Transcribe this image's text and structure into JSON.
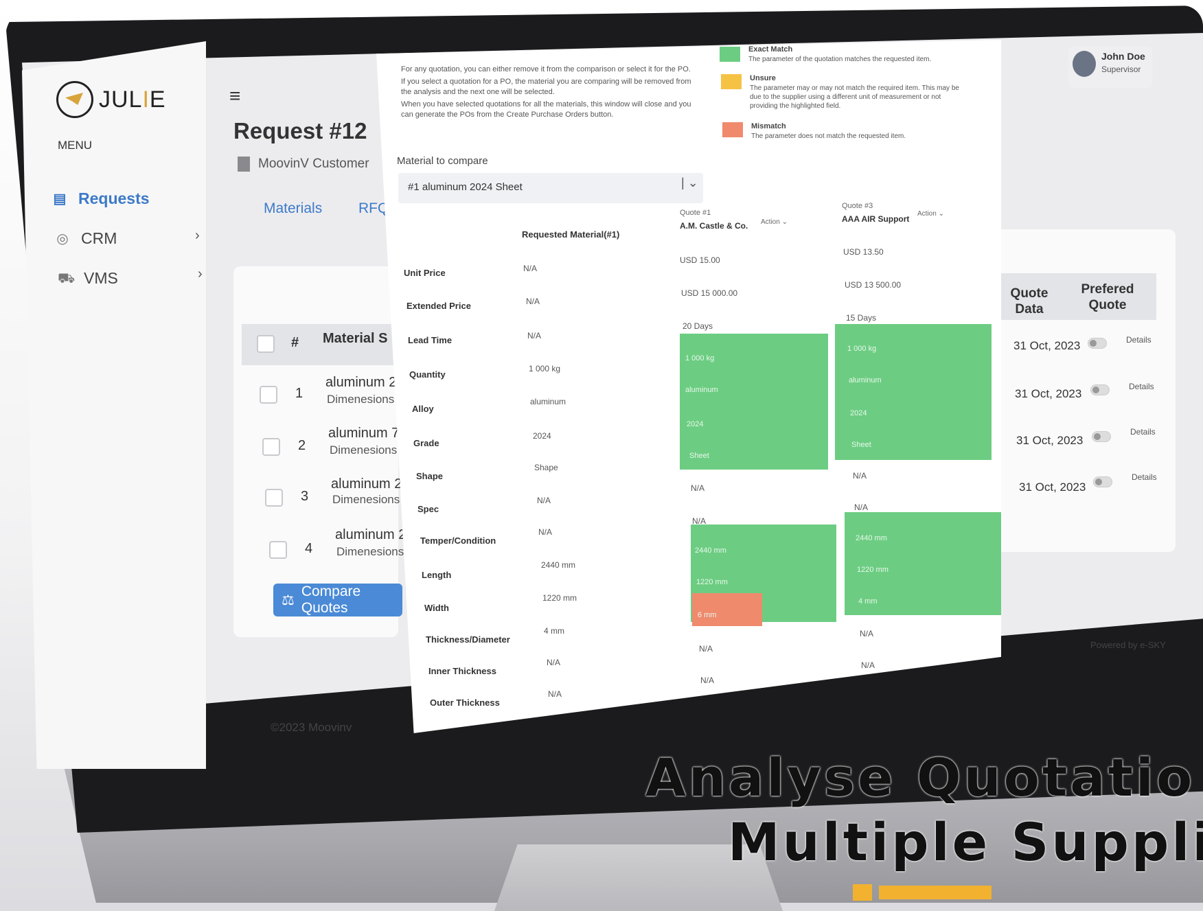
{
  "sidebar": {
    "logo_text_a": "JUL",
    "logo_text_b": "I",
    "logo_text_c": "E",
    "menu_label": "MENU",
    "items": [
      {
        "label": "Requests",
        "icon": "requests-icon"
      },
      {
        "label": "CRM",
        "icon": "user-circle-icon"
      },
      {
        "label": "VMS",
        "icon": "truck-icon"
      }
    ],
    "chevron": "›"
  },
  "header": {
    "title": "Request #12",
    "customer": "MoovinV Customer",
    "tabs": [
      "Materials",
      "RFQ"
    ]
  },
  "table": {
    "header_num": "#",
    "header_material": "Material S",
    "rows": [
      {
        "num": "1",
        "title": "aluminum 2",
        "sub": "Dimenesions"
      },
      {
        "num": "2",
        "title": "aluminum 7",
        "sub": "Dimenesions"
      },
      {
        "num": "3",
        "title": "aluminum 2",
        "sub": "Dimenesions"
      },
      {
        "num": "4",
        "title": "aluminum 2",
        "sub": "Dimenesions"
      }
    ],
    "compare_button": "Compare Quotes",
    "copyright": "©2023 Moovinv"
  },
  "right": {
    "col_quote_data": "Quote Data",
    "col_prefered": "Prefered Quote",
    "dates": [
      "31 Oct, 2023",
      "31 Oct, 2023",
      "31 Oct, 2023",
      "31 Oct, 2023"
    ],
    "details": "Details",
    "powered": "Powered by e-SKY"
  },
  "user": {
    "name": "John Doe",
    "role": "Supervisor"
  },
  "modal": {
    "notes": [
      "For any quotation, you can either remove it from the comparison or select it for the PO.",
      "If you select a quotation for a PO, the material you are comparing will be removed from the analysis and the next one will be selected.",
      "When you have selected quotations for all the materials, this window will close and you can generate the POs from the Create Purchase Orders button."
    ],
    "legend": [
      {
        "title": "Exact Match",
        "desc": "The parameter of the quotation matches the requested item.",
        "color": "#6ccd82"
      },
      {
        "title": "Unsure",
        "desc": "The parameter may or may not match the required item. This may be due to the supplier using a different unit of measurement or not providing the highlighted field.",
        "color": "#f5c244"
      },
      {
        "title": "Mismatch",
        "desc": "The parameter does not match the requested item.",
        "color": "#ef8a6d"
      }
    ],
    "material_label": "Material to compare",
    "material_value": "#1 aluminum 2024 Sheet",
    "requested_header": "Requested Material(#1)",
    "quotes": [
      {
        "label": "Quote #1",
        "name": "A.M. Castle & Co.",
        "action": "Action ⌄"
      },
      {
        "label": "Quote #3",
        "name": "AAA AIR Support",
        "action": "Action ⌄"
      }
    ],
    "rows": [
      {
        "label": "Unit Price",
        "req": "N/A",
        "q1": "USD 15.00",
        "q2": "USD 13.50"
      },
      {
        "label": "Extended Price",
        "req": "N/A",
        "q1": "USD 15 000.00",
        "q2": "USD 13 500.00"
      },
      {
        "label": "Lead Time",
        "req": "N/A",
        "q1": "20 Days",
        "q2": "15 Days"
      },
      {
        "label": "Quantity",
        "req": "1 000 kg",
        "q1": "1 000 kg",
        "q2": "1 000 kg"
      },
      {
        "label": "Alloy",
        "req": "aluminum",
        "q1": "aluminum",
        "q2": "aluminum"
      },
      {
        "label": "Grade",
        "req": "2024",
        "q1": "2024",
        "q2": "2024"
      },
      {
        "label": "Shape",
        "req": "Shape",
        "q1": "Sheet",
        "q2": "Sheet"
      },
      {
        "label": "Spec",
        "req": "N/A",
        "q1": "N/A",
        "q2": "N/A"
      },
      {
        "label": "Temper/Condition",
        "req": "N/A",
        "q1": "N/A",
        "q2": "N/A"
      },
      {
        "label": "Length",
        "req": "2440 mm",
        "q1": "2440 mm",
        "q2": "2440 mm"
      },
      {
        "label": "Width",
        "req": "1220 mm",
        "q1": "1220 mm",
        "q2": "1220 mm"
      },
      {
        "label": "Thickness/Diameter",
        "req": "4 mm",
        "q1": "6 mm",
        "q2": "4 mm"
      },
      {
        "label": "Inner Thickness",
        "req": "N/A",
        "q1": "N/A",
        "q2": "N/A"
      },
      {
        "label": "Outer Thickness",
        "req": "N/A",
        "q1": "N/A",
        "q2": "N/A"
      }
    ]
  },
  "caption": {
    "line1": "Analyse Quotatio",
    "line2": "Multiple Suppli"
  },
  "colors": {
    "accent": "#3d7ac7",
    "button": "#4a8ad6",
    "match": "#6ccd82",
    "mismatch": "#ef8a6d",
    "unsure": "#f5c244",
    "brand": "#d8a43a"
  }
}
